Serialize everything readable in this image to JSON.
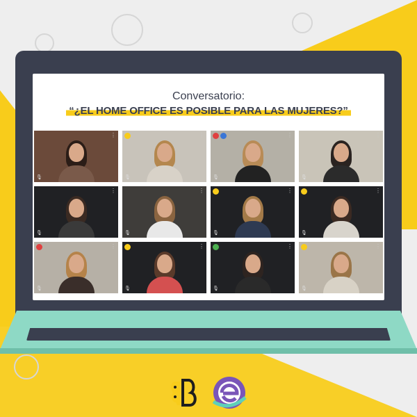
{
  "screen": {
    "title_line1": "Conversatorio:",
    "title_line2": "“¿EL HOME OFFICE ES POSIBLE PARA LAS MUJERES?”"
  },
  "tiles": [
    {
      "bg": "#6b4a3a",
      "hair": "#2b1d17",
      "shirt": "#7a5a4a",
      "dots": []
    },
    {
      "bg": "#c8c3ba",
      "hair": "#b4874e",
      "shirt": "#d8d2c8",
      "dots": [
        "#f8cc1b"
      ]
    },
    {
      "bg": "#b4b0a6",
      "hair": "#b88b56",
      "shirt": "#222222",
      "dots": [
        "#e04040",
        "#3a76d6"
      ]
    },
    {
      "bg": "#c9c4b8",
      "hair": "#2a2320",
      "shirt": "#2b2b2b",
      "dots": []
    },
    {
      "bg": "#202124",
      "hair": "#3a2a22",
      "shirt": "#3a3a3a",
      "dots": []
    },
    {
      "bg": "#3f3d3a",
      "hair": "#8a6440",
      "shirt": "#e8e8e8",
      "dots": []
    },
    {
      "bg": "#202124",
      "hair": "#a37a48",
      "shirt": "#2e3a52",
      "dots": [
        "#f8cc1b"
      ]
    },
    {
      "bg": "#202124",
      "hair": "#3b2a22",
      "shirt": "#d8d4cc",
      "dots": [
        "#f8cc1b"
      ]
    },
    {
      "bg": "#b6b0a6",
      "hair": "#b5834a",
      "shirt": "#3a2e2a",
      "dots": [
        "#e04040"
      ]
    },
    {
      "bg": "#202124",
      "hair": "#5a3a2a",
      "shirt": "#d45050",
      "dots": [
        "#f8cc1b"
      ]
    },
    {
      "bg": "#202124",
      "hair": "#2e2420",
      "shirt": "#2a2a2a",
      "dots": [
        "#4caf50"
      ]
    },
    {
      "bg": "#bdb6aa",
      "hair": "#9a7548",
      "shirt": "#d8d2c6",
      "dots": [
        "#f8cc1b"
      ]
    }
  ],
  "colors": {
    "accent_yellow": "#f8cc1b",
    "laptop_dark": "#3a3f4f",
    "keyboard_mint": "#8ed9c5"
  },
  "icons": {
    "logo_left": "brain-b-logo-icon",
    "logo_right": "e-logo-icon"
  }
}
